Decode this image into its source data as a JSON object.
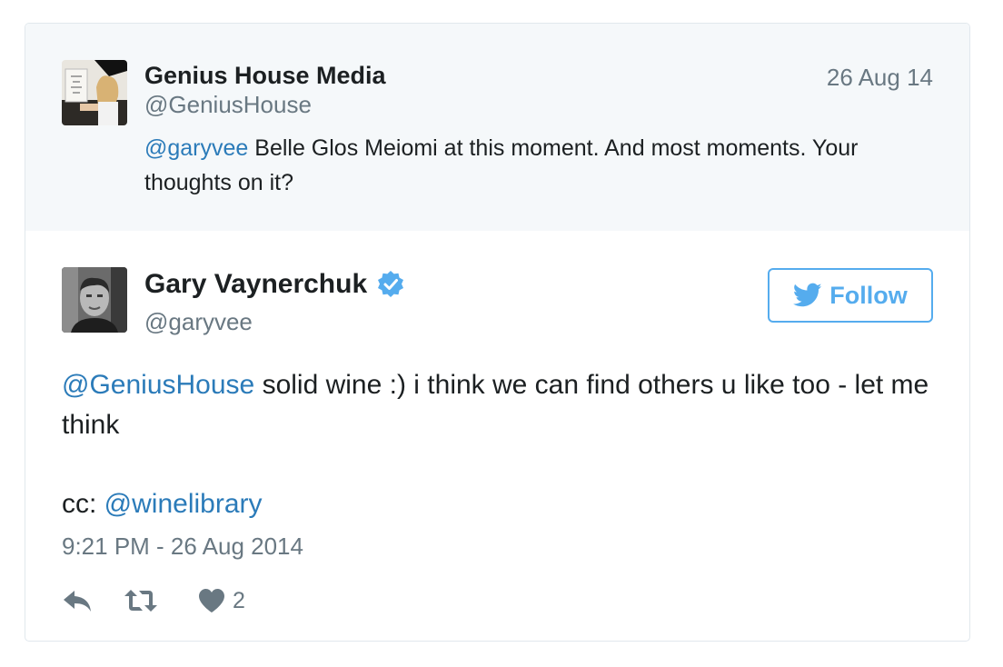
{
  "quoted_tweet": {
    "author_name": "Genius House Media",
    "author_handle": "@GeniusHouse",
    "date": "26 Aug 14",
    "mention": "@garyvee",
    "text": " Belle Glos Meiomi at this moment. And most moments. Your thoughts on it?"
  },
  "main_tweet": {
    "author_name": "Gary Vaynerchuk",
    "author_handle": "@garyvee",
    "verified": true,
    "follow_label": "Follow",
    "mention": "@GeniusHouse",
    "text": " solid wine :) i think we can find others u like too - let me think",
    "cc_prefix": "cc: ",
    "cc_mention": "@winelibrary",
    "timestamp": "9:21 PM - 26 Aug 2014",
    "like_count": "2"
  },
  "colors": {
    "link": "#2b7bb9",
    "twitter_blue": "#55acee",
    "secondary_text": "#697882",
    "quoted_background": "#f5f8fa"
  },
  "icons": {
    "reply": "reply-icon",
    "retweet": "retweet-icon",
    "like": "heart-icon",
    "verified": "verified-badge-icon",
    "follow": "twitter-bird-icon"
  }
}
